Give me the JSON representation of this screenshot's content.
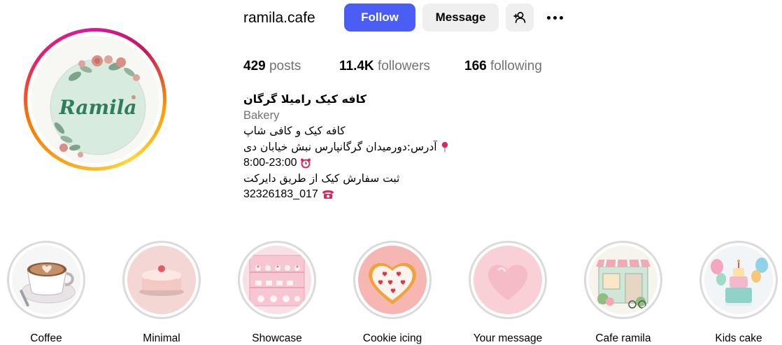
{
  "profile": {
    "username": "ramila.cafe",
    "avatar_logo_text": "Ramila",
    "follow_label": "Follow",
    "message_label": "Message"
  },
  "stats": {
    "posts_count": "429",
    "posts_label": "posts",
    "followers_count": "11.4K",
    "followers_label": "followers",
    "following_count": "166",
    "following_label": "following"
  },
  "bio": {
    "display_name": "کافه کیک رامیلا گرگان",
    "category": "Bakery",
    "line1": "کافه کیک و کافی شاپ",
    "line2": "آدرس:دورمیدان گرگانپارس نبش خیابان دی",
    "line3": "8:00-23:00",
    "line4": "ثبت سفارش کیک از طریق دایرکت",
    "line5": "32326183_017"
  },
  "highlights": [
    {
      "label": "Coffee",
      "icon": "coffee-cup-icon"
    },
    {
      "label": "Minimal",
      "icon": "cake-icon"
    },
    {
      "label": "Showcase",
      "icon": "display-case-icon"
    },
    {
      "label": "Cookie icing",
      "icon": "heart-cookie-icon"
    },
    {
      "label": "Your message",
      "icon": "heart-icon"
    },
    {
      "label": "Cafe ramila",
      "icon": "cafe-storefront-icon"
    },
    {
      "label": "Kids cake",
      "icon": "birthday-cake-icon"
    }
  ],
  "colors": {
    "follow_button": "#4a5df5",
    "secondary_button": "#efefef",
    "muted_text": "#737373",
    "highlight_ring": "#dbdbdb"
  }
}
